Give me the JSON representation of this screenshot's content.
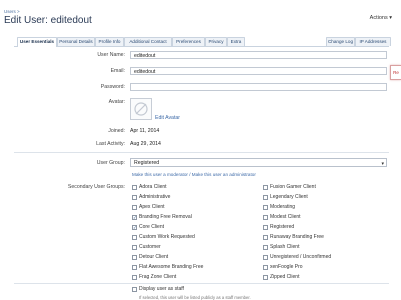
{
  "breadcrumb": "Users >",
  "page_title": "Edit User: editedout",
  "actions_label": "Actions",
  "tabs": [
    "User Essentials",
    "Personal Details",
    "Profile Info",
    "Additional Contact",
    "Preferences",
    "Privacy",
    "Extra",
    "Change Log",
    "IP Addresses"
  ],
  "form": {
    "username_label": "User Name:",
    "username_value": "editedout",
    "email_label": "Email:",
    "email_value": "editedout",
    "password_label": "Password:",
    "avatar_label": "Avatar:",
    "edit_avatar": "Edit Avatar",
    "joined_label": "Joined:",
    "joined_value": "Apr 11, 2014",
    "last_activity_label": "Last Activity:",
    "last_activity_value": "Aug 29, 2014",
    "user_group_label": "User Group:",
    "user_group_value": "Registered",
    "moderator_link": "Make this user a moderator",
    "admin_link": "Make this user an administrator",
    "links_separator": " / ",
    "secondary_label": "Secondary User Groups:",
    "red_tip": "Re"
  },
  "groups_left": [
    {
      "label": "Adora Client",
      "checked": false
    },
    {
      "label": "Administrative",
      "checked": false
    },
    {
      "label": "Apex Client",
      "checked": false
    },
    {
      "label": "Branding Free Removal",
      "checked": true
    },
    {
      "label": "Core Client",
      "checked": true
    },
    {
      "label": "Custom Work Requested",
      "checked": false
    },
    {
      "label": "Customer",
      "checked": false
    },
    {
      "label": "Detour Client",
      "checked": false
    },
    {
      "label": "Flat Awesome Branding Free",
      "checked": false
    },
    {
      "label": "Frag Zone Client",
      "checked": false
    }
  ],
  "groups_right": [
    {
      "label": "Fusion Gamer Client",
      "checked": false
    },
    {
      "label": "Legendary Client",
      "checked": false
    },
    {
      "label": "Moderating",
      "checked": false
    },
    {
      "label": "Modest Client",
      "checked": false
    },
    {
      "label": "Registered",
      "checked": false
    },
    {
      "label": "Runaway Branding Free",
      "checked": false
    },
    {
      "label": "Splash Client",
      "checked": false
    },
    {
      "label": "Unregistered / Unconfirmed",
      "checked": false
    },
    {
      "label": "xenFoogle Pro",
      "checked": false
    },
    {
      "label": "Zipped Client",
      "checked": false
    }
  ],
  "staff": {
    "label": "Display user as staff",
    "hint": "If selected, this user will be listed publicly as a staff member."
  }
}
